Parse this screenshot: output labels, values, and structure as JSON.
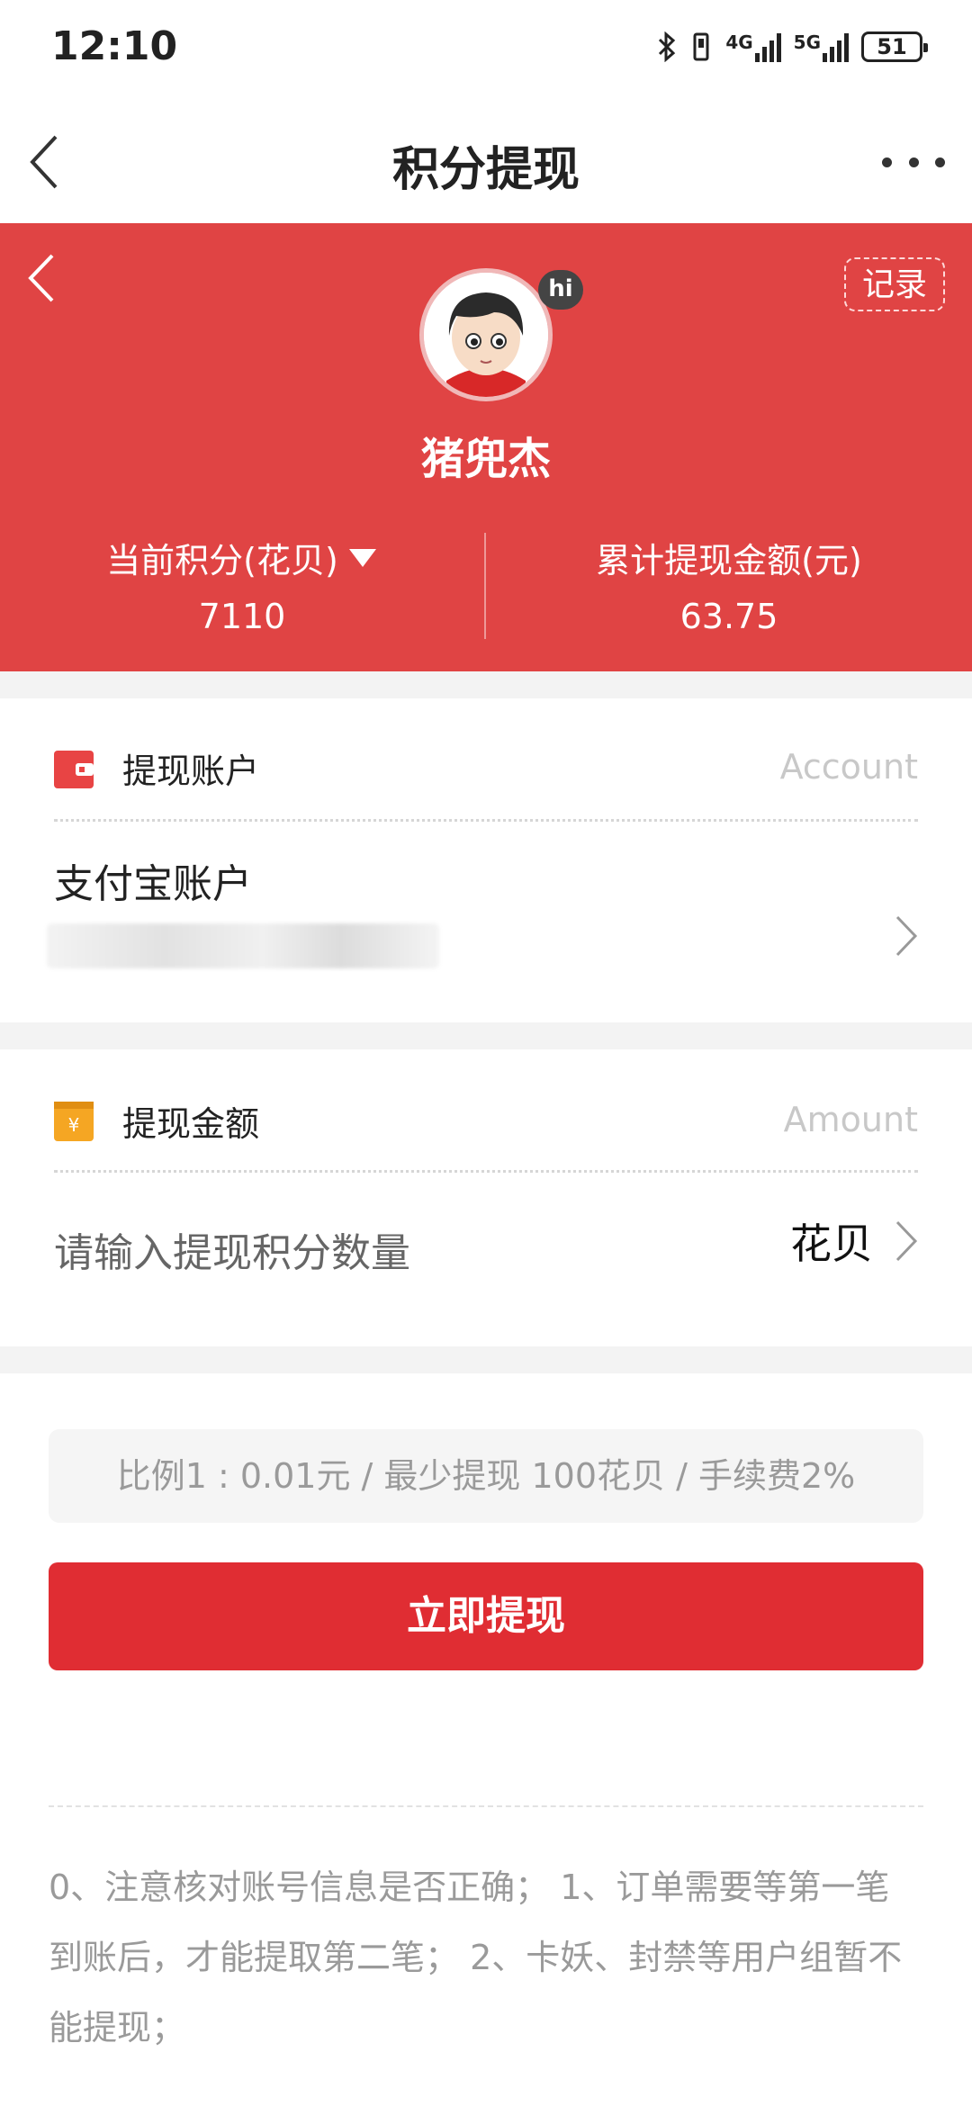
{
  "status_bar": {
    "time": "12:10",
    "network_1": "4G",
    "network_2": "5G",
    "battery": "51",
    "icons": [
      "bluetooth-icon",
      "vibrate-icon",
      "signal-icon",
      "battery-icon"
    ]
  },
  "nav": {
    "title": "积分提现",
    "icons": [
      "back-icon",
      "more-icon"
    ]
  },
  "hero": {
    "record_label": "记录",
    "hi_badge": "hi",
    "username": "猪兜杰",
    "stat_left_label": "当前积分(花贝)",
    "stat_left_value": "7110",
    "stat_right_label": "累计提现金额(元)",
    "stat_right_value": "63.75",
    "bg_color": "#e04444"
  },
  "account": {
    "title": "提现账户",
    "subtitle": "Account",
    "method": "支付宝账户"
  },
  "amount": {
    "title": "提现金额",
    "subtitle": "Amount",
    "placeholder": "请输入提现积分数量",
    "unit": "花贝"
  },
  "info": "比例1 : 0.01元 / 最少提现 100花贝 / 手续费2%",
  "submit_label": "立即提现",
  "notes": "0、注意核对账号信息是否正确； 1、订单需要等第一笔到账后，才能提取第二笔； 2、卡妖、封禁等用户组暂不能提现；",
  "colors": {
    "accent_red": "#e02d33",
    "wallet_icon": "#e84444",
    "amount_icon": "#f5a623"
  }
}
